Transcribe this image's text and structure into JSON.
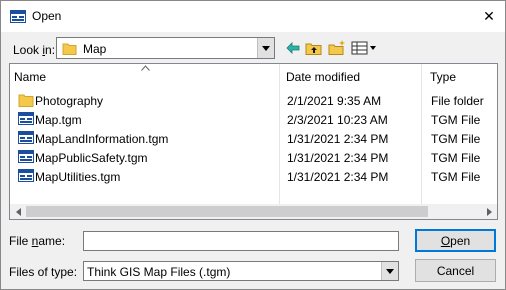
{
  "window": {
    "title": "Open",
    "close_glyph": "✕"
  },
  "lookin": {
    "label_pre": "Look ",
    "label_accel": "i",
    "label_post": "n:",
    "value": "Map"
  },
  "toolbar": [
    "back-icon",
    "up-folder-icon",
    "new-folder-icon",
    "view-menu-icon"
  ],
  "columns": {
    "name": "Name",
    "date": "Date modified",
    "type": "Type"
  },
  "files": [
    {
      "name": "Photography",
      "date": "2/1/2021 9:35 AM",
      "type": "File folder",
      "icon": "folder-icon"
    },
    {
      "name": "Map.tgm",
      "date": "2/3/2021 10:23 AM",
      "type": "TGM File",
      "icon": "tgm-file-icon"
    },
    {
      "name": "MapLandInformation.tgm",
      "date": "1/31/2021 2:34 PM",
      "type": "TGM File",
      "icon": "tgm-file-icon"
    },
    {
      "name": "MapPublicSafety.tgm",
      "date": "1/31/2021 2:34 PM",
      "type": "TGM File",
      "icon": "tgm-file-icon"
    },
    {
      "name": "MapUtilities.tgm",
      "date": "1/31/2021 2:34 PM",
      "type": "TGM File",
      "icon": "tgm-file-icon"
    }
  ],
  "filename": {
    "label_pre": "File ",
    "label_accel": "n",
    "label_post": "ame:",
    "value": ""
  },
  "filetype": {
    "label": "Files of type:",
    "value": "Think GIS Map Files (.tgm)"
  },
  "buttons": {
    "open_accel": "O",
    "open_rest": "pen",
    "cancel": "Cancel"
  },
  "colors": {
    "selection_border": "#0078d7",
    "folder": "#f4c94b"
  }
}
